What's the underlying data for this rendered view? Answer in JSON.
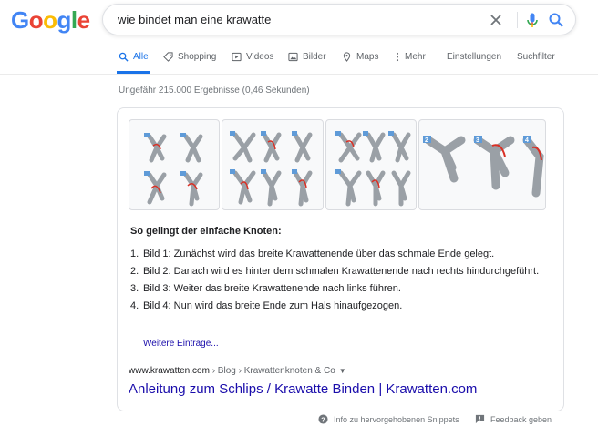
{
  "logo": {
    "letters": [
      {
        "ch": "G",
        "color": "#4285f4"
      },
      {
        "ch": "o",
        "color": "#ea4335"
      },
      {
        "ch": "o",
        "color": "#fbbc05"
      },
      {
        "ch": "g",
        "color": "#4285f4"
      },
      {
        "ch": "l",
        "color": "#34a853"
      },
      {
        "ch": "e",
        "color": "#ea4335"
      }
    ]
  },
  "search": {
    "query": "wie bindet man eine krawatte"
  },
  "tabs": {
    "all": "Alle",
    "shopping": "Shopping",
    "videos": "Videos",
    "images": "Bilder",
    "maps": "Maps",
    "more": "Mehr",
    "settings": "Einstellungen",
    "tools": "Suchfilter"
  },
  "stats": "Ungefähr 215.000 Ergebnisse (0,46 Sekunden)",
  "snippet": {
    "heading": "So gelingt der einfache Knoten:",
    "steps": [
      {
        "num": "1.",
        "text": "Bild 1: Zunächst wird das breite Krawattenende über das schmale Ende gelegt."
      },
      {
        "num": "2.",
        "text": "Bild 2: Danach wird es hinter dem schmalen Krawattenende nach rechts hindurchgeführt."
      },
      {
        "num": "3.",
        "text": "Bild 3: Weiter das breite Krawattenende nach links führen."
      },
      {
        "num": "4.",
        "text": "Bild 4: Nun wird das breite Ende zum Hals hinaufgezogen."
      }
    ],
    "more": "Weitere Einträge...",
    "cite_domain": "www.krawatten.com",
    "cite_path": " › Blog › Krawattenknoten & Co",
    "title": "Anleitung zum Schlips / Krawatte Binden | Krawatten.com"
  },
  "footer": {
    "about": "Info zu hervorgehobenen Snippets",
    "feedback": "Feedback geben"
  },
  "colors": {
    "link": "#1a0dab",
    "accent": "#1a73e8",
    "tie_red": "#d93025"
  }
}
